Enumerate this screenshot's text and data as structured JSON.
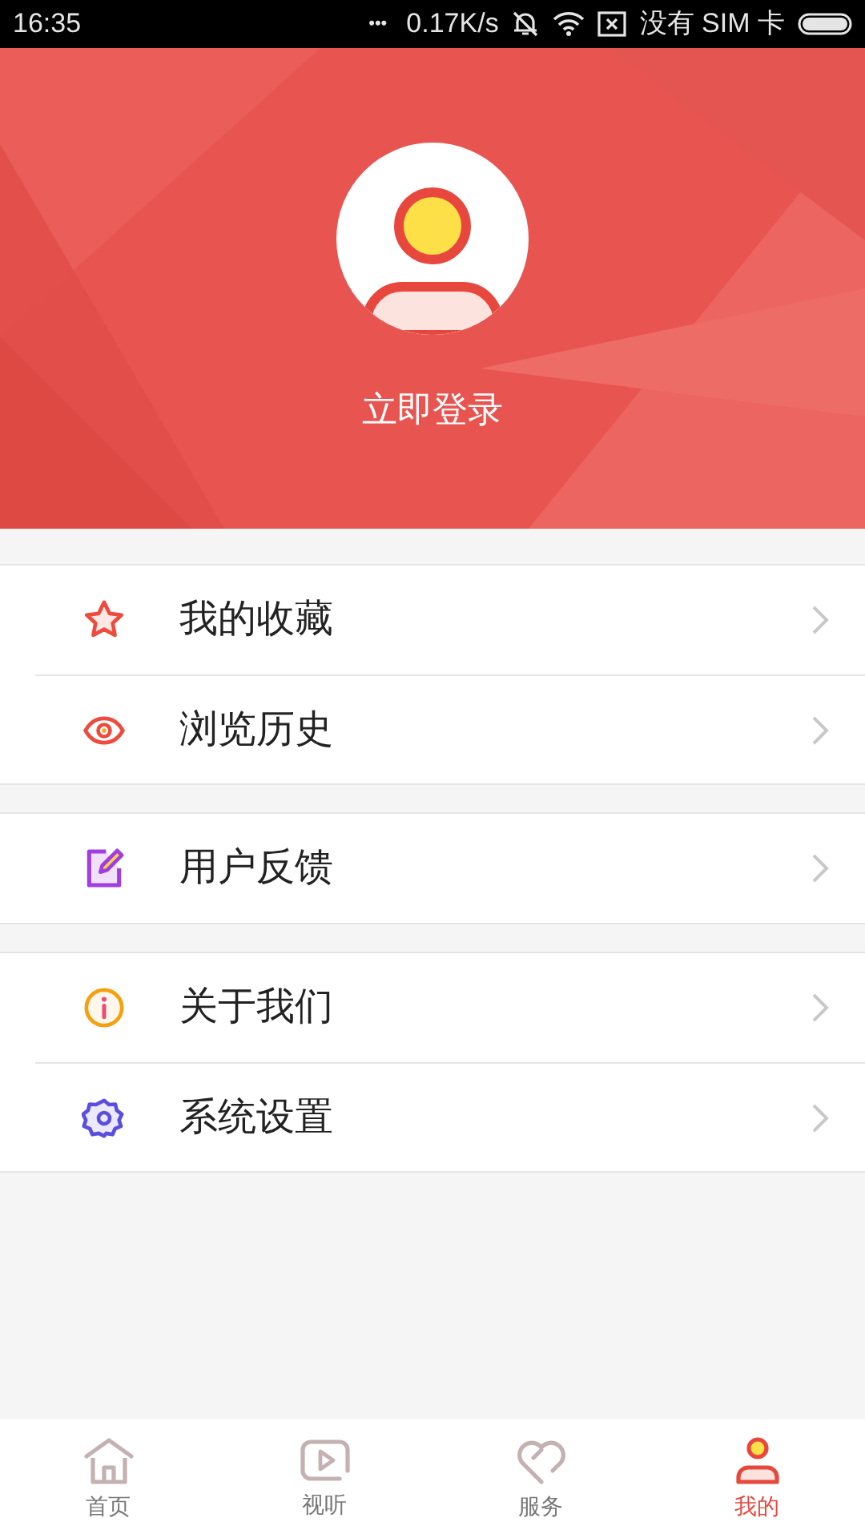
{
  "status_bar": {
    "time": "16:35",
    "dots": "•••",
    "speed": "0.17K/s",
    "carrier": "没有 SIM 卡"
  },
  "profile": {
    "login": "立即登录"
  },
  "menu_groups": [
    {
      "items": [
        {
          "kind": "star",
          "label": "我的收藏"
        },
        {
          "kind": "eye",
          "label": "浏览历史"
        }
      ]
    },
    {
      "items": [
        {
          "kind": "edit",
          "label": "用户反馈"
        }
      ]
    },
    {
      "items": [
        {
          "kind": "info",
          "label": "关于我们"
        },
        {
          "kind": "gear",
          "label": "系统设置"
        }
      ]
    }
  ],
  "tabs": [
    {
      "kind": "home",
      "label": "首页",
      "selected": false
    },
    {
      "kind": "video",
      "label": "视听",
      "selected": false
    },
    {
      "kind": "heart",
      "label": "服务",
      "selected": false
    },
    {
      "kind": "user",
      "label": "我的",
      "selected": true
    }
  ]
}
